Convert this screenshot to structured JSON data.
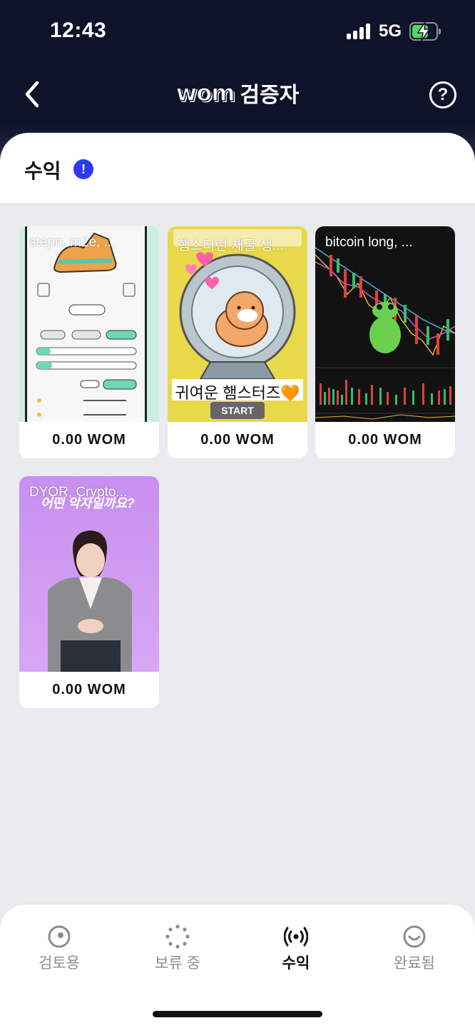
{
  "status": {
    "time": "12:43",
    "network": "5G"
  },
  "header": {
    "logo": "wom",
    "title": "검증자"
  },
  "section": {
    "title": "수익"
  },
  "cards": [
    {
      "title": "stepn, m2e, ...",
      "amount": "0.00 WOM"
    },
    {
      "title": "햄스터런 채굴 생...",
      "amount": "0.00 WOM",
      "overlay_text": "귀여운 햄스터즈🧡",
      "button": "START"
    },
    {
      "title": "bitcoin long, ...",
      "amount": "0.00 WOM"
    },
    {
      "title": "DYOR, Crypto...",
      "amount": "0.00 WOM",
      "overlay_text": "어떤 악자일까요?"
    }
  ],
  "tabs": [
    {
      "label": "검토용",
      "icon": "eye-icon"
    },
    {
      "label": "보류 중",
      "icon": "loading-dots-icon"
    },
    {
      "label": "수익",
      "icon": "broadcast-icon",
      "active": true
    },
    {
      "label": "완료됨",
      "icon": "smile-icon"
    }
  ],
  "colors": {
    "header_bg": "#0f1329",
    "accent": "#2d3bf0",
    "page_bg": "#e9ebef"
  }
}
